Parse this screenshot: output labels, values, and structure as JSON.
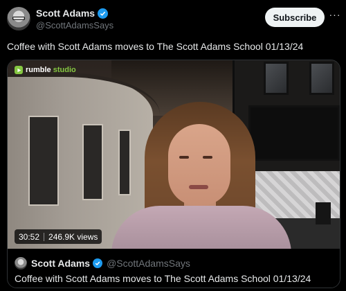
{
  "post": {
    "author_name": "Scott Adams",
    "handle": "@ScottAdamsSays",
    "subscribe_label": "Subscribe",
    "more_icon": "more-icon",
    "text": "Coffee with Scott Adams moves to The Scott Adams School 01/13/24"
  },
  "video": {
    "brand": "rumble",
    "brand_suffix": "studio",
    "duration": "30:52",
    "views": "246.9K views"
  },
  "quote": {
    "author_name": "Scott Adams",
    "handle": "@ScottAdamsSays",
    "text": "Coffee with Scott Adams moves to The Scott Adams School 01/13/24"
  },
  "colors": {
    "verified": "#1d9bf0",
    "rumble_green": "#85c742",
    "muted_text": "#71767b"
  }
}
